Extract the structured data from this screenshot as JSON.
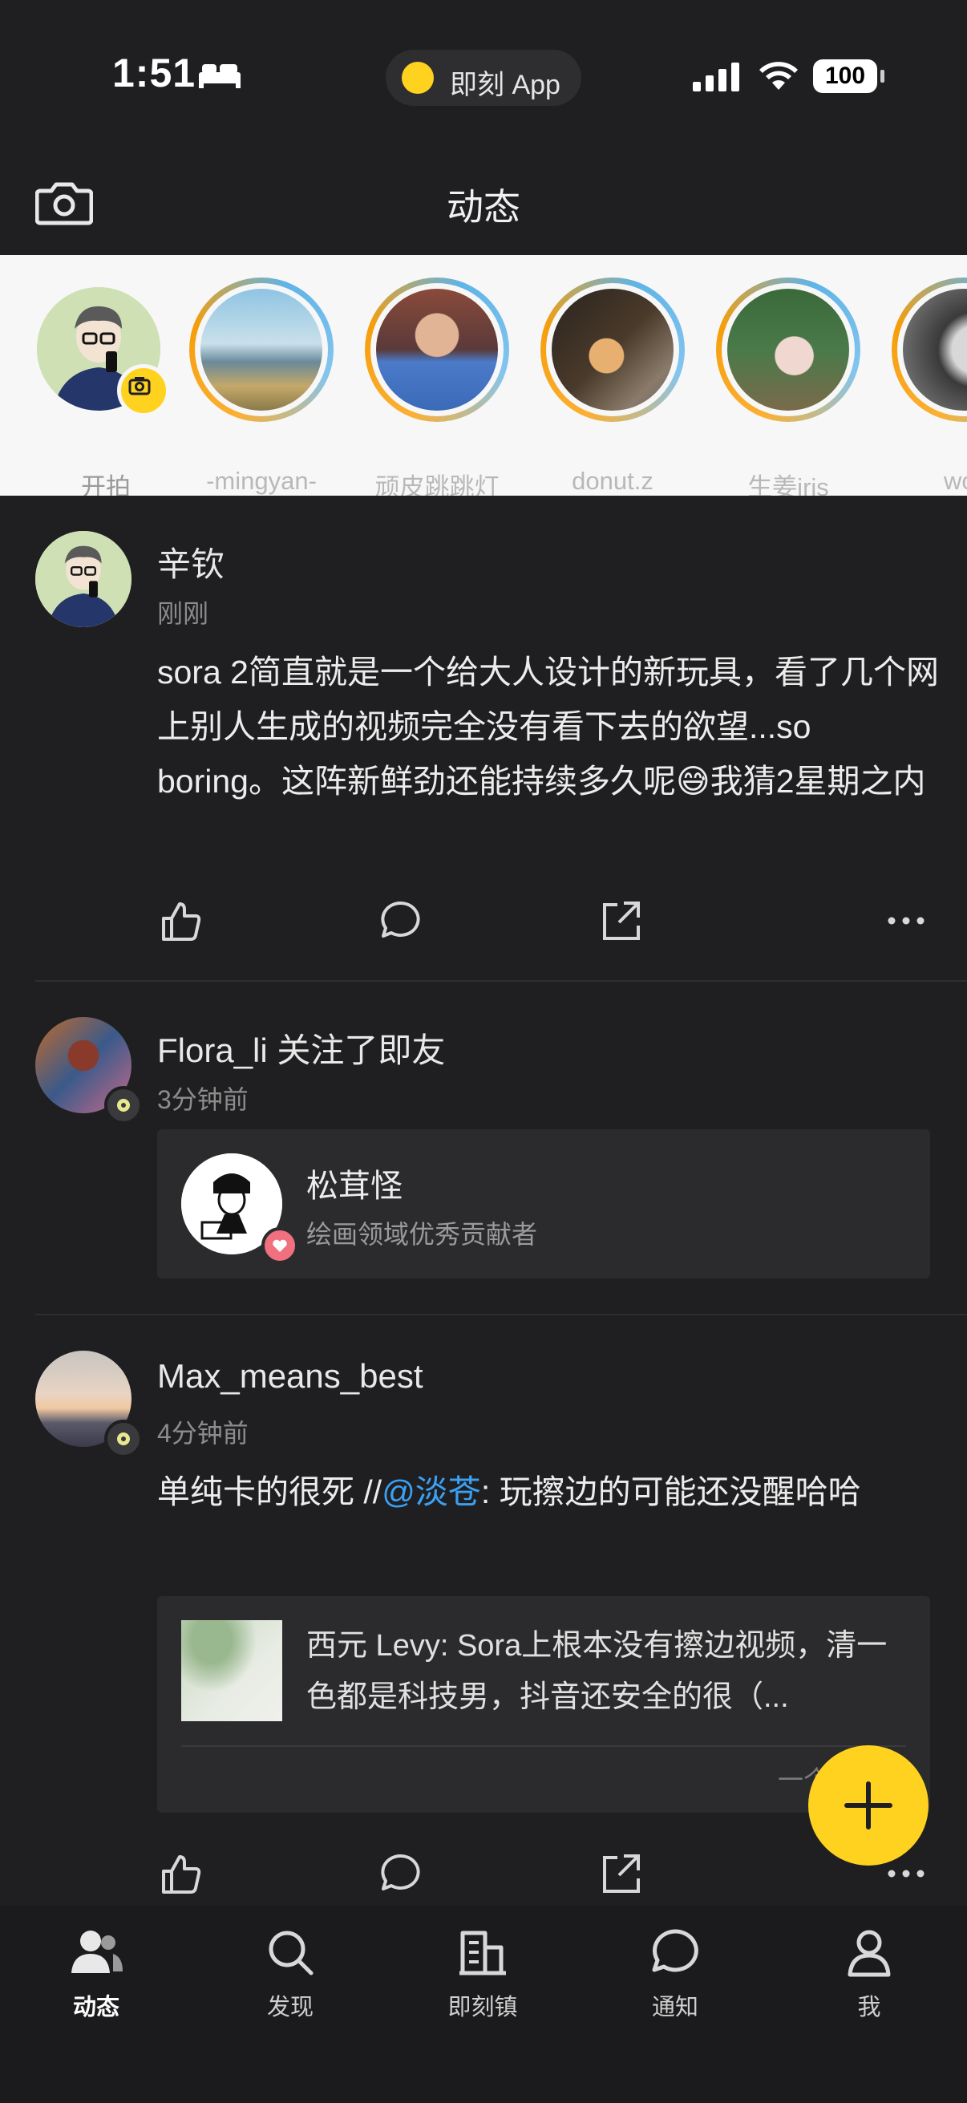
{
  "status_bar": {
    "time": "1:51",
    "app_name": "即刻 App",
    "battery": "100"
  },
  "header": {
    "title": "动态"
  },
  "stories": [
    {
      "name": "开拍"
    },
    {
      "name": "-mingyan-"
    },
    {
      "name": "顽皮跳跳灯"
    },
    {
      "name": "donut.z"
    },
    {
      "name": "生姜iris"
    },
    {
      "name": "wor"
    }
  ],
  "posts": [
    {
      "author": "辛钦",
      "time": "刚刚",
      "text": "sora 2简直就是一个给大人设计的新玩具，看了几个网上别人生成的视频完全没有看下去的欲望...so boring。这阵新鲜劲还能持续多久呢😅我猜2星期之内"
    },
    {
      "author": "Flora_li 关注了即友",
      "time": "3分钟前",
      "card": {
        "name": "松茸怪",
        "desc": "绘画领域优秀贡献者"
      }
    },
    {
      "author": "Max_means_best",
      "time": "4分钟前",
      "text_prefix": "单纯卡的很死 //",
      "mention": "@淡苍",
      "text_suffix": ":  玩擦边的可能还没醒哈哈",
      "card": {
        "text": "西元 Levy: Sora上根本没有擦边视频，清一色都是科技男，抖音还安全的很（...",
        "footer": "一个想法不"
      }
    }
  ],
  "tabs": [
    {
      "label": "动态",
      "icon": "people-icon",
      "active": true
    },
    {
      "label": "发现",
      "icon": "search-icon",
      "active": false
    },
    {
      "label": "即刻镇",
      "icon": "building-icon",
      "active": false
    },
    {
      "label": "通知",
      "icon": "chat-bubble-icon",
      "active": false
    },
    {
      "label": "我",
      "icon": "person-icon",
      "active": false
    }
  ],
  "colors": {
    "accent": "#ffd21f",
    "background": "#1f1f21",
    "mention": "#3ba0f2"
  }
}
